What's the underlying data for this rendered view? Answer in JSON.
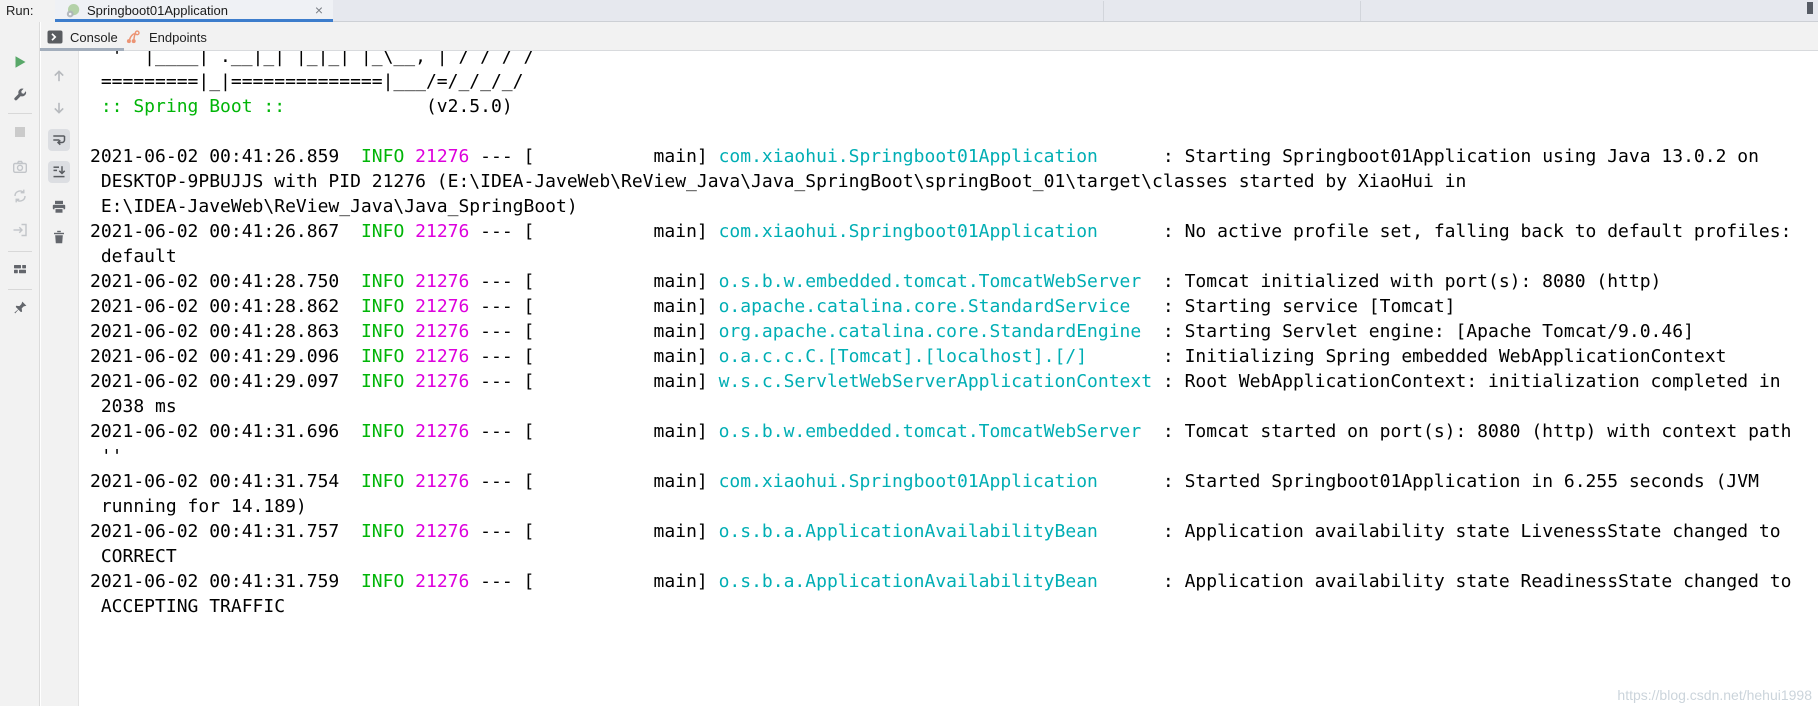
{
  "header": {
    "run_label": "Run:",
    "tab": {
      "title": "Springboot01Application",
      "close_glyph": "×"
    }
  },
  "view_tabs": {
    "console": {
      "label": "Console"
    },
    "endpoints": {
      "label": "Endpoints"
    }
  },
  "icons": {
    "run-icon": "green play triangle",
    "settings-icon": "wrench",
    "stop-icon": "gray square (disabled)",
    "thread-dump-icon": "camera (disabled)",
    "rerun-icon": "circular arrows (disabled)",
    "exit-icon": "door with arrow (disabled)",
    "layout-icon": "window panels",
    "pin-icon": "pin",
    "up-icon": "arrow up (disabled)",
    "down-icon": "arrow down (disabled)",
    "soft-wrap-icon": "return arrow over lines (toggled on)",
    "scroll-end-icon": "arrow to bottom line (toggled on)",
    "print-icon": "printer",
    "clear-icon": "trash can",
    "console-tab-icon": "dark terminal square with white chevron",
    "endpoints-icon": "orange endpoints graph",
    "spring-boot-icon": "translucent green circle with gear badge",
    "close-icon": "×"
  },
  "colors": {
    "accent_tab_underline": "#3D7DCC",
    "console_tab_underline": "#A3AEBC",
    "info_green": "#00B507",
    "pid_magenta": "#DD00DD",
    "logger_cyan": "#00AEB4",
    "endpoints_orange": "#EC9474",
    "run_green": "#59A869"
  },
  "console": {
    "rows": [
      {
        "s": [
          [
            "p",
            "  '  |____| .__|_| |_|_| |_\\__, | / / / /"
          ]
        ]
      },
      {
        "s": [
          [
            "p",
            " =========|_|==============|___/=/_/_/_/"
          ]
        ]
      },
      {
        "s": [
          [
            "g",
            " :: Spring Boot ::"
          ],
          [
            "p",
            "             (v2.5.0)"
          ]
        ]
      },
      {
        "s": [
          [
            "p",
            ""
          ]
        ]
      },
      {
        "s": [
          [
            "p",
            "2021-06-02 00:41:26.859  "
          ],
          [
            "g",
            "INFO"
          ],
          [
            "p",
            " "
          ],
          [
            "m",
            "21276"
          ],
          [
            "p",
            " --- [           main] "
          ],
          [
            "c",
            "com.xiaohui.Springboot01Application"
          ],
          [
            "p",
            "      : Starting Springboot01Application using Java 13.0.2 on"
          ]
        ]
      },
      {
        "s": [
          [
            "p",
            " DESKTOP-9PBUJJS with PID 21276 (E:\\IDEA-JaveWeb\\ReView_Java\\Java_SpringBoot\\springBoot_01\\target\\classes started by XiaoHui in"
          ]
        ]
      },
      {
        "s": [
          [
            "p",
            " E:\\IDEA-JaveWeb\\ReView_Java\\Java_SpringBoot)"
          ]
        ]
      },
      {
        "s": [
          [
            "p",
            "2021-06-02 00:41:26.867  "
          ],
          [
            "g",
            "INFO"
          ],
          [
            "p",
            " "
          ],
          [
            "m",
            "21276"
          ],
          [
            "p",
            " --- [           main] "
          ],
          [
            "c",
            "com.xiaohui.Springboot01Application"
          ],
          [
            "p",
            "      : No active profile set, falling back to default profiles:"
          ]
        ]
      },
      {
        "s": [
          [
            "p",
            " default"
          ]
        ]
      },
      {
        "s": [
          [
            "p",
            "2021-06-02 00:41:28.750  "
          ],
          [
            "g",
            "INFO"
          ],
          [
            "p",
            " "
          ],
          [
            "m",
            "21276"
          ],
          [
            "p",
            " --- [           main] "
          ],
          [
            "c",
            "o.s.b.w.embedded.tomcat.TomcatWebServer"
          ],
          [
            "p",
            "  : Tomcat initialized with port(s): 8080 (http)"
          ]
        ]
      },
      {
        "s": [
          [
            "p",
            "2021-06-02 00:41:28.862  "
          ],
          [
            "g",
            "INFO"
          ],
          [
            "p",
            " "
          ],
          [
            "m",
            "21276"
          ],
          [
            "p",
            " --- [           main] "
          ],
          [
            "c",
            "o.apache.catalina.core.StandardService"
          ],
          [
            "p",
            "   : Starting service [Tomcat]"
          ]
        ]
      },
      {
        "s": [
          [
            "p",
            "2021-06-02 00:41:28.863  "
          ],
          [
            "g",
            "INFO"
          ],
          [
            "p",
            " "
          ],
          [
            "m",
            "21276"
          ],
          [
            "p",
            " --- [           main] "
          ],
          [
            "c",
            "org.apache.catalina.core.StandardEngine"
          ],
          [
            "p",
            "  : Starting Servlet engine: [Apache Tomcat/9.0.46]"
          ]
        ]
      },
      {
        "s": [
          [
            "p",
            "2021-06-02 00:41:29.096  "
          ],
          [
            "g",
            "INFO"
          ],
          [
            "p",
            " "
          ],
          [
            "m",
            "21276"
          ],
          [
            "p",
            " --- [           main] "
          ],
          [
            "c",
            "o.a.c.c.C.[Tomcat].[localhost].[/]"
          ],
          [
            "p",
            "       : Initializing Spring embedded WebApplicationContext"
          ]
        ]
      },
      {
        "s": [
          [
            "p",
            "2021-06-02 00:41:29.097  "
          ],
          [
            "g",
            "INFO"
          ],
          [
            "p",
            " "
          ],
          [
            "m",
            "21276"
          ],
          [
            "p",
            " --- [           main] "
          ],
          [
            "c",
            "w.s.c.ServletWebServerApplicationContext"
          ],
          [
            "p",
            " : Root WebApplicationContext: initialization completed in"
          ]
        ]
      },
      {
        "s": [
          [
            "p",
            " 2038 ms"
          ]
        ]
      },
      {
        "s": [
          [
            "p",
            "2021-06-02 00:41:31.696  "
          ],
          [
            "g",
            "INFO"
          ],
          [
            "p",
            " "
          ],
          [
            "m",
            "21276"
          ],
          [
            "p",
            " --- [           main] "
          ],
          [
            "c",
            "o.s.b.w.embedded.tomcat.TomcatWebServer"
          ],
          [
            "p",
            "  : Tomcat started on port(s): 8080 (http) with context path"
          ]
        ]
      },
      {
        "s": [
          [
            "p",
            " ''"
          ]
        ]
      },
      {
        "s": [
          [
            "p",
            "2021-06-02 00:41:31.754  "
          ],
          [
            "g",
            "INFO"
          ],
          [
            "p",
            " "
          ],
          [
            "m",
            "21276"
          ],
          [
            "p",
            " --- [           main] "
          ],
          [
            "c",
            "com.xiaohui.Springboot01Application"
          ],
          [
            "p",
            "      : Started Springboot01Application in 6.255 seconds (JVM"
          ]
        ]
      },
      {
        "s": [
          [
            "p",
            " running for 14.189)"
          ]
        ]
      },
      {
        "s": [
          [
            "p",
            "2021-06-02 00:41:31.757  "
          ],
          [
            "g",
            "INFO"
          ],
          [
            "p",
            " "
          ],
          [
            "m",
            "21276"
          ],
          [
            "p",
            " --- [           main] "
          ],
          [
            "c",
            "o.s.b.a.ApplicationAvailabilityBean"
          ],
          [
            "p",
            "      : Application availability state LivenessState changed to"
          ]
        ]
      },
      {
        "s": [
          [
            "p",
            " CORRECT"
          ]
        ]
      },
      {
        "s": [
          [
            "p",
            "2021-06-02 00:41:31.759  "
          ],
          [
            "g",
            "INFO"
          ],
          [
            "p",
            " "
          ],
          [
            "m",
            "21276"
          ],
          [
            "p",
            " --- [           main] "
          ],
          [
            "c",
            "o.s.b.a.ApplicationAvailabilityBean"
          ],
          [
            "p",
            "      : Application availability state ReadinessState changed to"
          ]
        ]
      },
      {
        "s": [
          [
            "p",
            " ACCEPTING TRAFFIC"
          ]
        ]
      }
    ]
  },
  "watermark": {
    "text": "https://blog.csdn.net/hehui1998"
  }
}
